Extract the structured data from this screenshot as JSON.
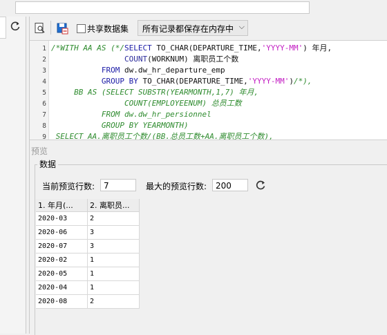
{
  "toolbar": {
    "share_dataset_label": "共享数据集",
    "save_mode_value": "所有记录都保存在内存中"
  },
  "editor": {
    "line_numbers": [
      "1",
      "2",
      "3",
      "4",
      "5",
      "6",
      "7",
      "8",
      "9"
    ]
  },
  "preview": {
    "title": "预览",
    "group_label": "数据",
    "current_rows_label": "当前预览行数:",
    "current_rows_value": "7",
    "max_rows_label": "最大的预览行数:",
    "max_rows_value": "200",
    "columns": [
      "1. 年月(...",
      "2. 离职员..."
    ],
    "rows": [
      [
        "2020-03",
        "2"
      ],
      [
        "2020-06",
        "3"
      ],
      [
        "2020-07",
        "3"
      ],
      [
        "2020-02",
        "1"
      ],
      [
        "2020-05",
        "1"
      ],
      [
        "2020-04",
        "1"
      ],
      [
        "2020-08",
        "2"
      ]
    ]
  }
}
